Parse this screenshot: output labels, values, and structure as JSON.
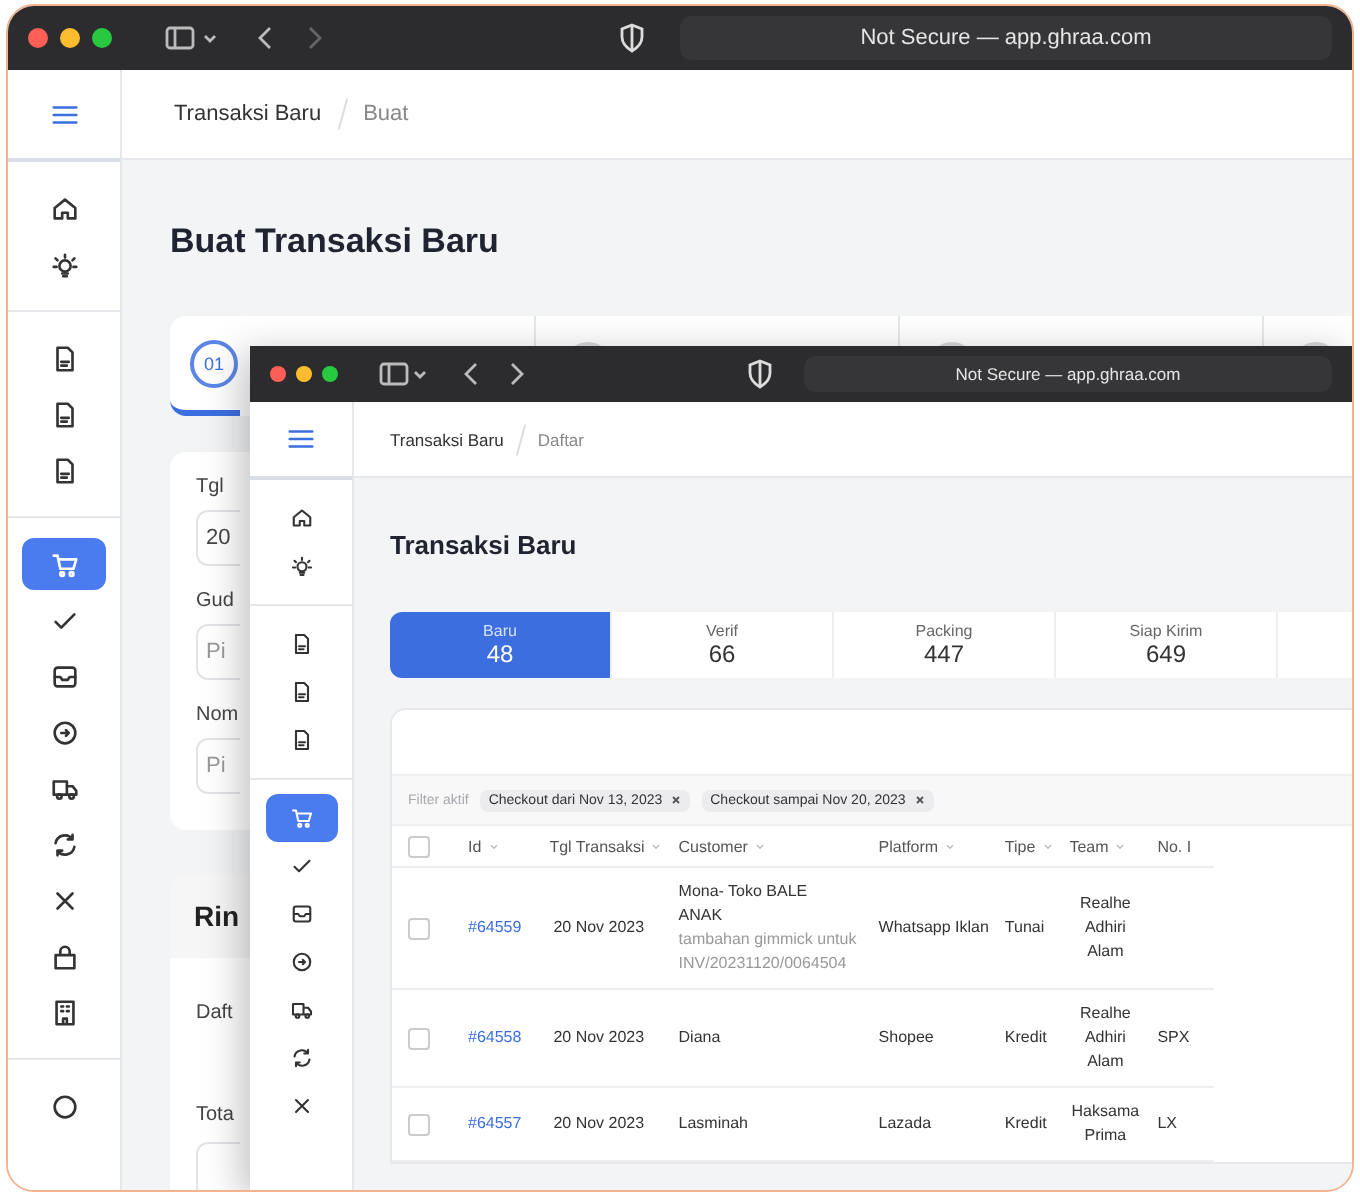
{
  "back_window": {
    "address": "Not Secure — app.ghraa.com",
    "breadcrumb": [
      "Transaksi Baru",
      "Buat"
    ],
    "sidebar": {
      "groups": [
        [
          {
            "kind": "home",
            "selected": false
          },
          {
            "kind": "bulb",
            "selected": false
          }
        ],
        [
          {
            "kind": "doc",
            "selected": false
          },
          {
            "kind": "doc",
            "selected": false
          },
          {
            "kind": "doc",
            "selected": false
          }
        ],
        [
          {
            "kind": "cart",
            "selected": true
          },
          {
            "kind": "check",
            "selected": false
          },
          {
            "kind": "box",
            "selected": false
          },
          {
            "kind": "arrow",
            "selected": false
          },
          {
            "kind": "truck",
            "selected": false
          },
          {
            "kind": "refresh",
            "selected": false
          },
          {
            "kind": "close",
            "selected": false
          },
          {
            "kind": "bag",
            "selected": false
          },
          {
            "kind": "building",
            "selected": false
          }
        ],
        [
          {
            "kind": "circle",
            "selected": false
          }
        ]
      ]
    },
    "title": "Buat Transaksi Baru",
    "steps": [
      {
        "number": "01",
        "selected": true
      }
    ],
    "form": [
      {
        "label": "Tgl",
        "value": "20"
      },
      {
        "label": "Gud",
        "placeholder": "Pi"
      },
      {
        "label": "Nom",
        "placeholder": "Pi"
      }
    ],
    "detail_card": {
      "title": "Rin",
      "labels": [
        "Daft",
        "Tota"
      ]
    }
  },
  "front_window": {
    "address": "Not Secure — app.ghraa.com",
    "breadcrumb": [
      "Transaksi Baru",
      "Daftar"
    ],
    "sidebar": {
      "groups": [
        [
          {
            "kind": "home",
            "selected": false
          },
          {
            "kind": "bulb",
            "selected": false
          }
        ],
        [
          {
            "kind": "doc",
            "selected": false
          },
          {
            "kind": "doc",
            "selected": false
          },
          {
            "kind": "doc",
            "selected": false
          }
        ],
        [
          {
            "kind": "cart",
            "selected": true
          },
          {
            "kind": "check",
            "selected": false
          },
          {
            "kind": "box",
            "selected": false
          },
          {
            "kind": "arrow",
            "selected": false
          },
          {
            "kind": "truck",
            "selected": false
          },
          {
            "kind": "refresh",
            "selected": false
          },
          {
            "kind": "close",
            "selected": false
          }
        ]
      ]
    },
    "title": "Transaksi Baru",
    "tabs": [
      {
        "label": "Baru",
        "count": "48",
        "selected": true
      },
      {
        "label": "Verif",
        "count": "66",
        "selected": false
      },
      {
        "label": "Packing",
        "count": "447",
        "selected": false
      },
      {
        "label": "Siap Kirim",
        "count": "649",
        "selected": false
      }
    ],
    "filter": {
      "label": "Filter aktif",
      "chips": [
        "Checkout dari Nov 13, 2023",
        "Checkout sampai Nov 20, 2023"
      ]
    },
    "table": {
      "select_all_checked": false,
      "columns": [
        {
          "label": "Id",
          "sortable": true
        },
        {
          "label": "Tgl Transaksi",
          "sortable": true
        },
        {
          "label": "Customer",
          "sortable": true
        },
        {
          "label": "Platform",
          "sortable": true
        },
        {
          "label": "Tipe",
          "sortable": true
        },
        {
          "label": "Team",
          "sortable": true
        },
        {
          "label": "No. I",
          "sortable": false
        }
      ],
      "rows": [
        {
          "checked": false,
          "id": "#64559",
          "date": "20 Nov 2023",
          "customer": "Mona- Toko BALE ANAK",
          "note": "tambahan gimmick untuk INV/20231120/0064504",
          "platform": "Whatsapp Iklan",
          "type": "Tunai",
          "team": "Realhe Adhiri Alam",
          "column_7": ""
        },
        {
          "checked": false,
          "id": "#64558",
          "date": "20 Nov 2023",
          "customer": "Diana",
          "note": "",
          "platform": "Shopee",
          "type": "Kredit",
          "team": "Realhe Adhiri Alam",
          "column_7": "SPX"
        },
        {
          "checked": false,
          "id": "#64557",
          "date": "20 Nov 2023",
          "customer": "Lasminah",
          "note": "",
          "platform": "Lazada",
          "type": "Kredit",
          "team": "Haksama Prima",
          "column_7": "LX"
        }
      ]
    }
  }
}
